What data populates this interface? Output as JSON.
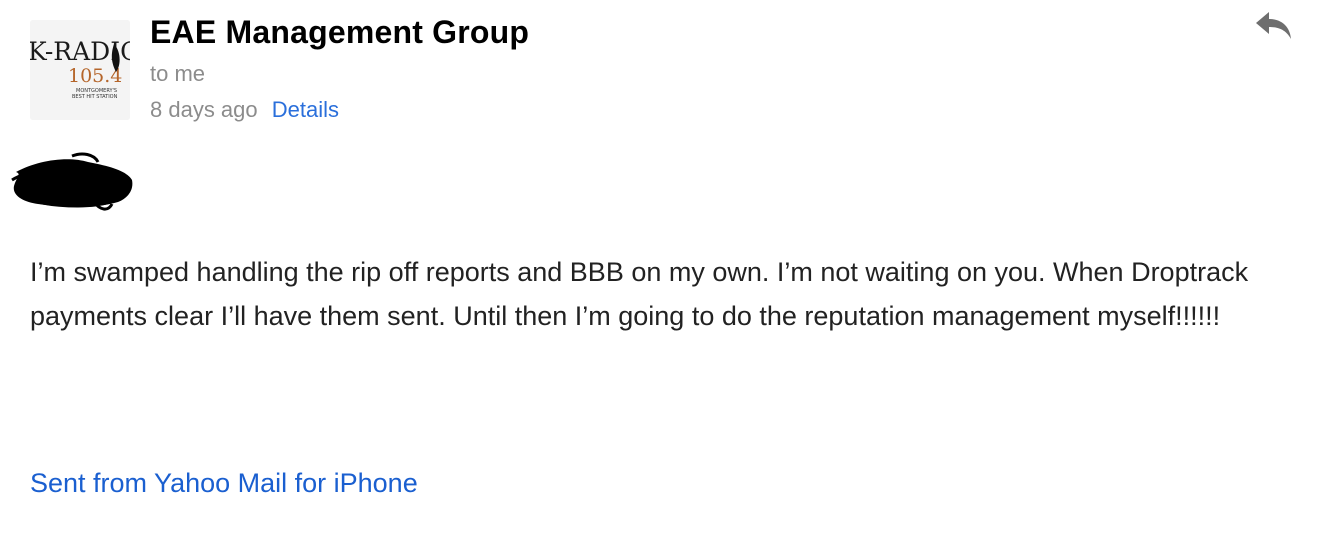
{
  "email": {
    "sender": "EAE Management Group",
    "recipient": "to me",
    "date": "8 days ago",
    "details_label": "Details",
    "body": "I’m swamped handling the rip off reports and BBB on my own. I’m not waiting on you. When Droptrack payments clear I’ll have them sent. Until then I’m going to do the reputation management myself!!!!!!",
    "signature": "Sent from Yahoo Mail for iPhone"
  },
  "avatar_logo": {
    "line1": "K-RADIO",
    "line2": "105.4",
    "line3": "MONTGOMERY'S",
    "line4": "BEST HIT STATION"
  },
  "icons": {
    "reply": "reply-arrow-icon",
    "redaction": "scribble-redaction"
  },
  "colors": {
    "link": "#2a6fdb",
    "signature_link": "#1a5fd0",
    "meta_text": "#8c8c8c",
    "body_text": "#222222"
  }
}
